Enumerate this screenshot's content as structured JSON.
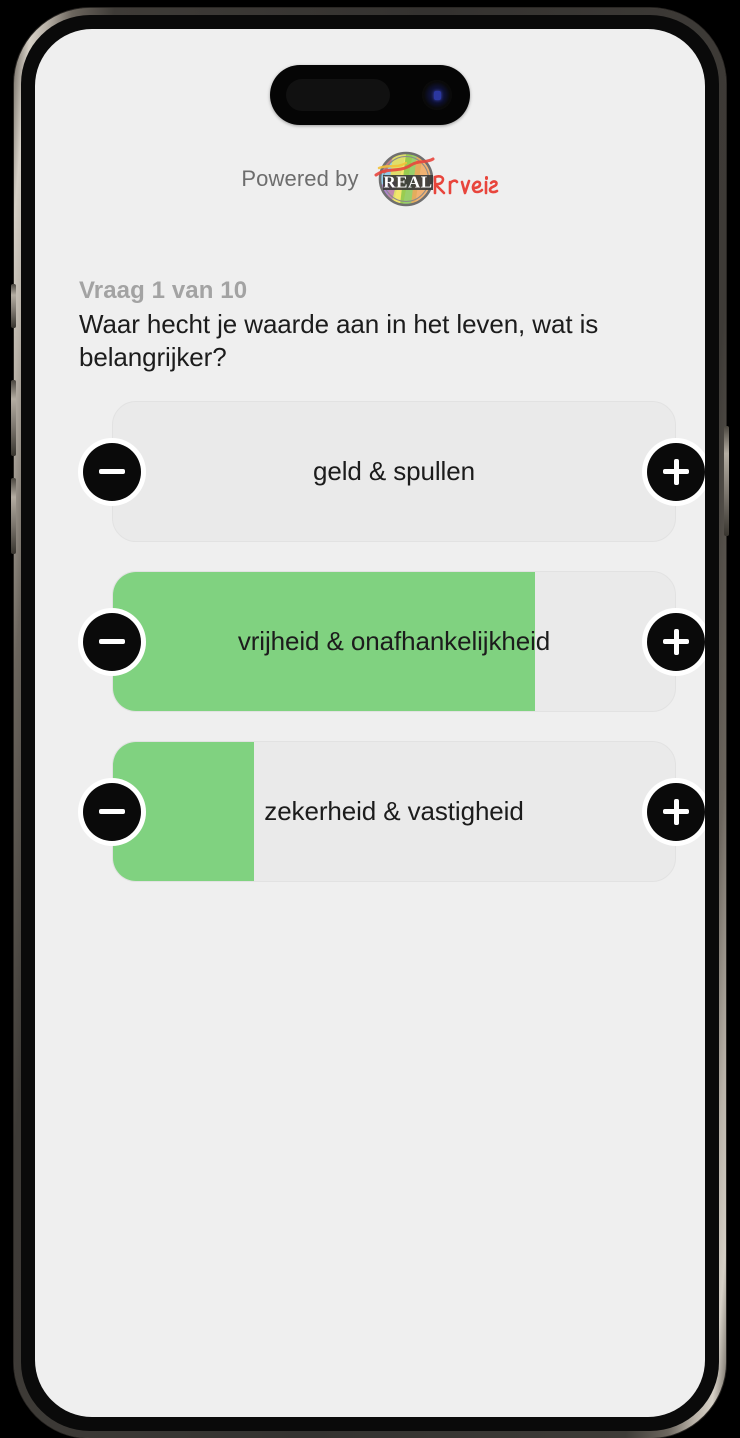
{
  "device": {
    "name": "iphone-15-pro",
    "frame_color": "#3a3734",
    "screen_background": "#efefef",
    "dynamic_island": {
      "name": "dynamic-island",
      "camera_color": "#2b37a0"
    },
    "buttons": [
      {
        "name": "action-button",
        "side": "left"
      },
      {
        "name": "volume-up-button",
        "side": "left"
      },
      {
        "name": "volume-down-button",
        "side": "left"
      },
      {
        "name": "power-button",
        "side": "right"
      }
    ]
  },
  "header": {
    "powered_by_label": "Powered by",
    "brand": {
      "name": "real-drives-logo",
      "word_mark": "REAL",
      "script_mark": "Drives",
      "script_color": "#e8453c"
    }
  },
  "question": {
    "counter": "Vraag 1 van 10",
    "text": "Waar hecht je waarde aan in het leven, wat is belangrijker?"
  },
  "colors": {
    "fill_green": "#80d280",
    "track_gray": "#eaeaea",
    "track_border": "#e2e2e2",
    "button_black": "#0a0a0a",
    "counter_gray": "#a3a3a3",
    "text_black": "#1c1c1c"
  },
  "controls": {
    "decrease_label": "−",
    "increase_label": "+",
    "decrease_name": "minus-icon",
    "increase_name": "plus-icon"
  },
  "answers": [
    {
      "label": "geld & spullen",
      "fill_percent": 0,
      "fill_css": "0%"
    },
    {
      "label": "vrijheid & onafhankelijkheid",
      "fill_percent": 75,
      "fill_css": "75%"
    },
    {
      "label": "zekerheid & vastigheid",
      "fill_percent": 25,
      "fill_css": "25%"
    }
  ]
}
